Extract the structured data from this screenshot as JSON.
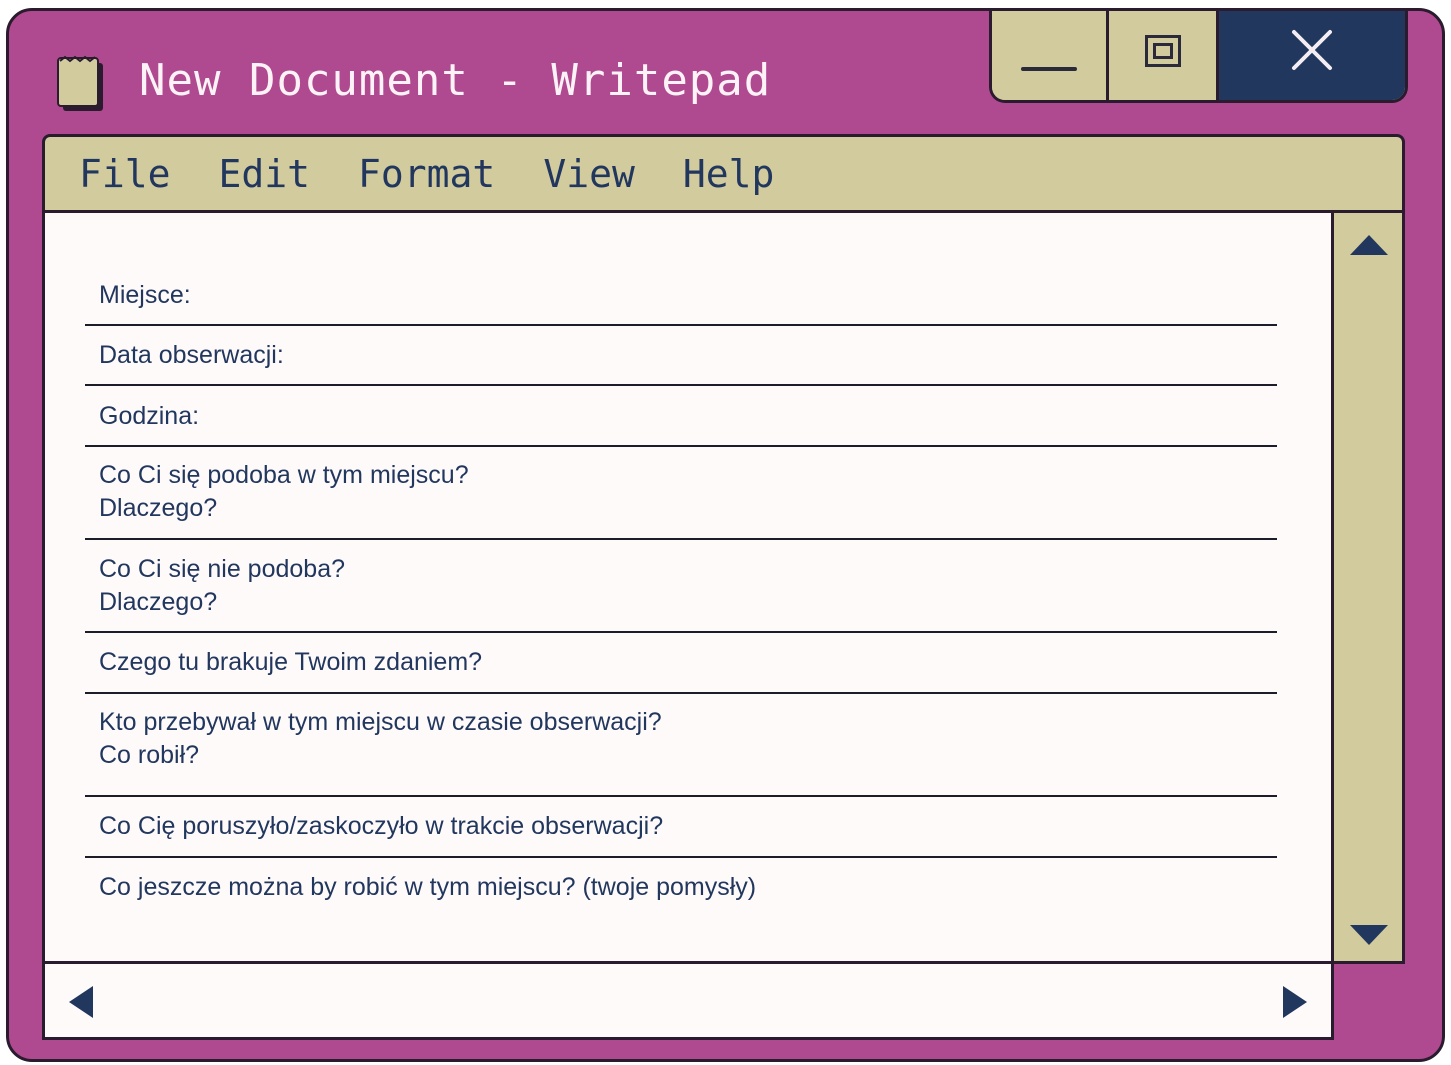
{
  "window": {
    "title": "New Document - Writepad",
    "colors": {
      "frame": "#b04a90",
      "panel": "#d2cb9e",
      "accent": "#22375e",
      "paper": "#fefafa"
    }
  },
  "title_icon": "notepad-icon",
  "controls": {
    "minimize_icon": "minimize-icon",
    "maximize_icon": "maximize-icon",
    "close_icon": "close-icon",
    "close_glyph": "✕"
  },
  "menu": {
    "items": [
      "File",
      "Edit",
      "Format",
      "View",
      "Help"
    ]
  },
  "form": {
    "fields": [
      "Miejsce:",
      "Data obserwacji:",
      "Godzina:",
      "Co Ci się podoba w tym miejscu?\nDlaczego?",
      "Co Ci się nie podoba?\nDlaczego?",
      "Czego tu brakuje Twoim zdaniem?",
      "Kto przebywał w tym miejscu w czasie obserwacji?\nCo robił?",
      "Co Cię poruszyło/zaskoczyło w trakcie obserwacji?",
      "Co jeszcze można by robić w tym miejscu? (twoje pomysły)"
    ]
  },
  "scrollbars": {
    "up_icon": "scroll-up-icon",
    "down_icon": "scroll-down-icon",
    "left_icon": "scroll-left-icon",
    "right_icon": "scroll-right-icon"
  }
}
